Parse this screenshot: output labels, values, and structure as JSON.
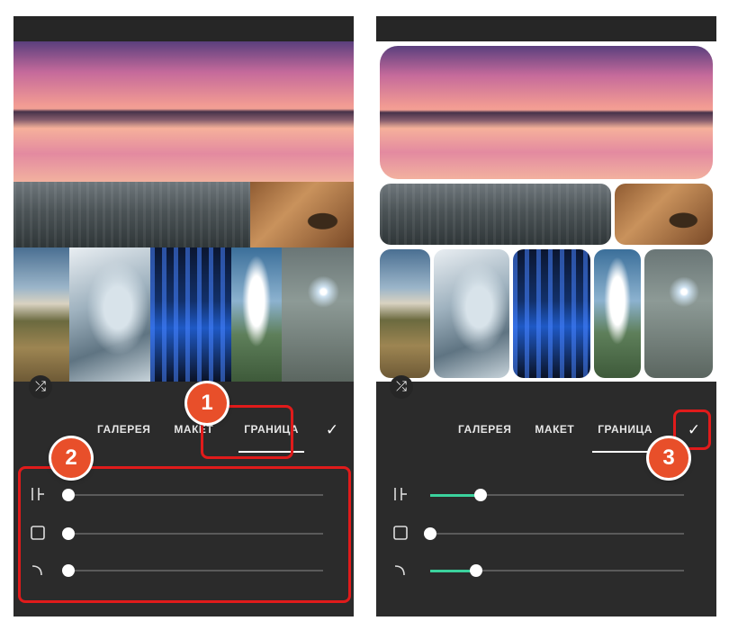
{
  "left_screen": {
    "tabs": [
      {
        "label": "ГАЛЕРЕЯ"
      },
      {
        "label": "МАКЕТ"
      },
      {
        "label": "ГРАНИЦА"
      }
    ],
    "active_tab": "ГРАНИЦА",
    "sliders": [
      {
        "icon": "inner-border-icon",
        "value": 0.0
      },
      {
        "icon": "outer-border-icon",
        "value": 0.0
      },
      {
        "icon": "corner-radius-icon",
        "value": 0.0
      }
    ]
  },
  "right_screen": {
    "tabs": [
      {
        "label": "ГАЛЕРЕЯ"
      },
      {
        "label": "МАКЕТ"
      },
      {
        "label": "ГРАНИЦА"
      }
    ],
    "active_tab": "ГРАНИЦА",
    "sliders": [
      {
        "icon": "inner-border-icon",
        "value": 0.2
      },
      {
        "icon": "outer-border-icon",
        "value": 0.0
      },
      {
        "icon": "corner-radius-icon",
        "value": 0.18
      }
    ]
  },
  "annotations": [
    {
      "number": "1"
    },
    {
      "number": "2"
    },
    {
      "number": "3"
    }
  ],
  "colors": {
    "panel": "#2b2b2b",
    "slider_fill": "#3bd29d",
    "highlight": "#e01b1b",
    "badge": "#e84f2a"
  }
}
